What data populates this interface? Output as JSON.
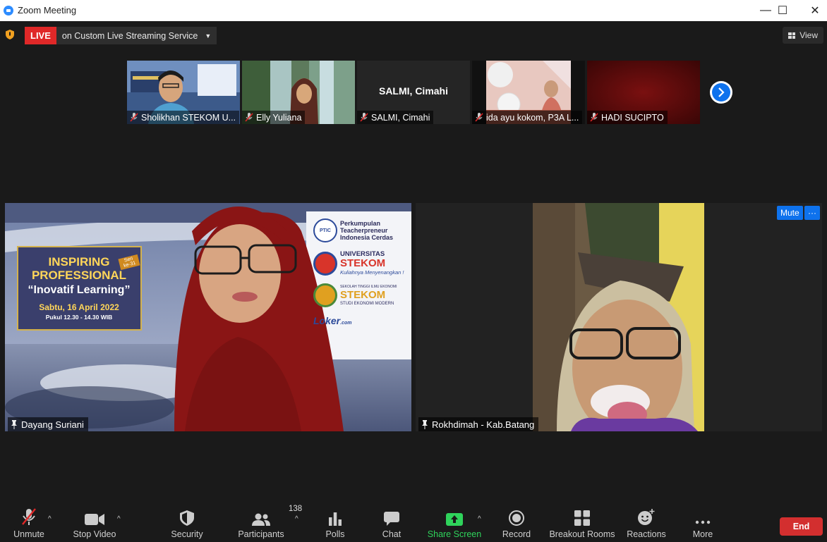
{
  "window": {
    "title": "Zoom Meeting",
    "minimize": "—",
    "maximize": "☐",
    "close": "✕"
  },
  "live": {
    "badge": "LIVE",
    "service": "on Custom Live Streaming Service",
    "caret": "▼"
  },
  "view_button": {
    "label": "View"
  },
  "thumbnails": [
    {
      "name": "Sholikhan STEKOM U..."
    },
    {
      "name": "Elly Yuliana"
    },
    {
      "name": "SALMI, Cimahi",
      "center_text": "SALMI, Cimahi"
    },
    {
      "name": "ida ayu kokom, P3A L..."
    },
    {
      "name": "HADI SUCIPTO"
    }
  ],
  "main_tiles": [
    {
      "name": "Dayang Suriani",
      "background": {
        "title1": "INSPIRING",
        "title2": "PROFESSIONAL",
        "seri": "Seri ke-31",
        "subtitle": "“Inovatif Learning”",
        "date": "Sabtu, 16 April 2022",
        "time": "Pukul 12.30 - 14.30 WIB",
        "org1a": "Perkumpulan",
        "org1b": "Teacherpreneur",
        "org1c": "Indonesia Cerdas",
        "ptic": "PTIC",
        "org2a": "UNIVERSITAS",
        "org2b": "STEKOM",
        "org2c": "Kuliahnya Menyenangkan !",
        "org3a": "SEKOLAH TINGGI ILMU EKONOMI",
        "org3b": "STEKOM",
        "org3c": "STUDI EKONOMI MODERN",
        "org4": "Loker",
        "org4b": ".com"
      }
    },
    {
      "name": "Rokhdimah - Kab.Batang"
    }
  ],
  "tile_actions": {
    "mute": "Mute",
    "more": "···"
  },
  "toolbar": {
    "unmute": "Unmute",
    "stop_video": "Stop Video",
    "security": "Security",
    "participants": "Participants",
    "participants_count": "138",
    "polls": "Polls",
    "chat": "Chat",
    "share_screen": "Share Screen",
    "record": "Record",
    "breakout_rooms": "Breakout Rooms",
    "reactions": "Reactions",
    "more": "More",
    "end": "End",
    "caret": "^"
  },
  "colors": {
    "accent": "#0e72ed",
    "live": "#e02828",
    "share": "#2fd35b",
    "end": "#d32f2f"
  }
}
